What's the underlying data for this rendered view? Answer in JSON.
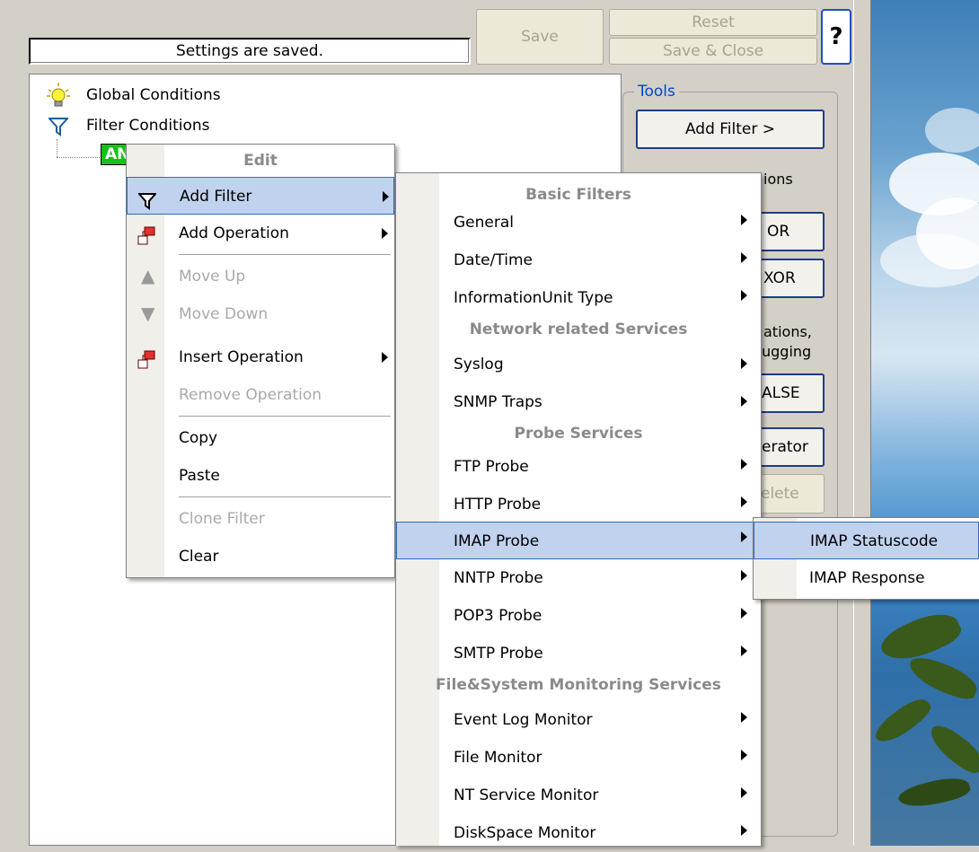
{
  "topbar": {
    "status_text": "Settings are saved.",
    "save_label": "Save",
    "reset_label": "Reset",
    "save_close_label": "Save & Close",
    "help_label": "?"
  },
  "tree": {
    "global_conditions": "Global Conditions",
    "filter_conditions": "Filter Conditions",
    "and_node": "AN"
  },
  "tools": {
    "legend": "Tools",
    "add_filter": "Add Filter >",
    "partial_texts": [
      "ions",
      "OR",
      "XOR",
      "ations,",
      "ugging",
      "ALSE",
      "erator",
      "elete"
    ]
  },
  "context_menu": {
    "header": "Edit",
    "items": [
      {
        "label": "Add Filter",
        "icon": "filter-icon",
        "submenu": true,
        "selected": true
      },
      {
        "label": "Add Operation",
        "icon": "operation-icon",
        "submenu": true
      },
      {
        "label": "Move Up",
        "icon": "arrow-up-icon",
        "disabled": true
      },
      {
        "label": "Move Down",
        "icon": "arrow-down-icon",
        "disabled": true
      },
      {
        "label": "Insert Operation",
        "icon": "operation-icon",
        "submenu": true
      },
      {
        "label": "Remove Operation",
        "disabled": true
      },
      {
        "label": "Copy"
      },
      {
        "label": "Paste"
      },
      {
        "label": "Clone Filter",
        "disabled": true
      },
      {
        "label": "Clear"
      }
    ]
  },
  "filter_menu": {
    "sections": {
      "basic": "Basic Filters",
      "network": "Network related Services",
      "probe": "Probe Services",
      "filesystem": "File&System Monitoring Services"
    },
    "items": {
      "general": "General",
      "datetime": "Date/Time",
      "infounit": "InformationUnit Type",
      "syslog": "Syslog",
      "snmp": "SNMP Traps",
      "ftp": "FTP Probe",
      "http": "HTTP Probe",
      "imap": "IMAP Probe",
      "nntp": "NNTP Probe",
      "pop3": "POP3 Probe",
      "smtp": "SMTP Probe",
      "eventlog": "Event Log Monitor",
      "filemon": "File Monitor",
      "ntservice": "NT Service Monitor",
      "diskspace": "DiskSpace Monitor"
    }
  },
  "imap_menu": {
    "statuscode": "IMAP Statuscode",
    "response": "IMAP Response"
  },
  "colors": {
    "menu_highlight": "#c1d2ee",
    "menu_highlight_border": "#316ac5",
    "and_node": "#18c018",
    "tools_legend": "#0046d5"
  }
}
